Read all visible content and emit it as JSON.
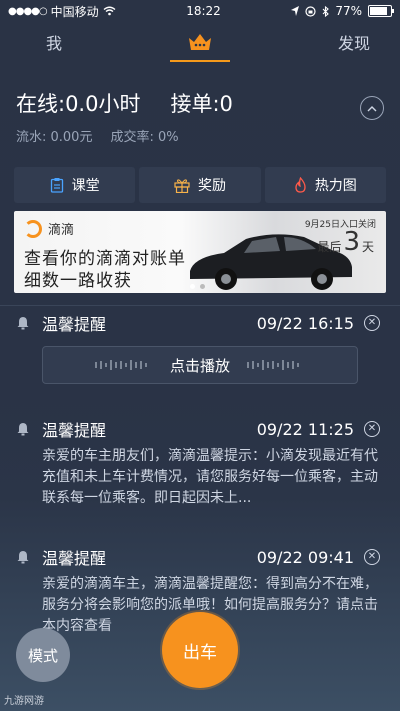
{
  "statusbar": {
    "carrier": "中国移动",
    "time": "18:22",
    "battery": "77%",
    "battery_fraction": 0.77
  },
  "tabs": {
    "left": "我",
    "right": "发现",
    "center_icon": "crown-icon"
  },
  "stats": {
    "online": "在线:0.0小时",
    "orders": "接单:0",
    "revenue": "流水: 0.00元",
    "rate": "成交率: 0%"
  },
  "quick": [
    {
      "label": "课堂",
      "icon": "clipboard-icon"
    },
    {
      "label": "奖励",
      "icon": "gift-icon"
    },
    {
      "label": "热力图",
      "icon": "flame-icon"
    }
  ],
  "banner": {
    "brand": "滴滴",
    "line1": "查看你的滴滴对账单",
    "line2": "细数一路收获",
    "notice": "9月25日入口关闭",
    "days_prefix": "最后",
    "days_num": "3",
    "days_suffix": "天"
  },
  "messages": [
    {
      "title": "温馨提醒",
      "time": "09/22 16:15",
      "audio_label": "点击播放"
    },
    {
      "title": "温馨提醒",
      "time": "09/22 11:25",
      "body": "亲爱的车主朋友们，滴滴温馨提示：小滴发现最近有代充值和未上车计费情况，请您服务好每一位乘客，主动联系每一位乘客。即日起因未上..."
    },
    {
      "title": "温馨提醒",
      "time": "09/22 09:41",
      "body": "亲爱的滴滴车主，滴滴温馨提醒您：得到高分不在难，服务分将会影响您的派单哦！如何提高服务分？请点击本内容查看"
    }
  ],
  "bottom": {
    "mode_label": "模式",
    "go_label": "出车"
  },
  "watermark": "九游网游"
}
